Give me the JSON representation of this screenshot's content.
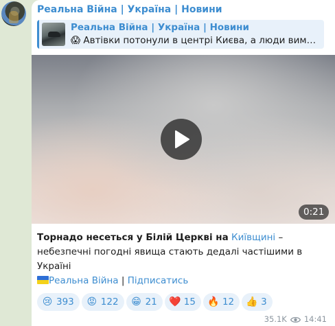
{
  "channel": {
    "name": "Реальна Війна | Україна | Новини"
  },
  "reply": {
    "name": "Реальна Війна | Україна | Новини",
    "emoji": "😱",
    "text": "Автівки потонули в центрі Києва, а люди вимушен…"
  },
  "video": {
    "duration": "0:21"
  },
  "caption": {
    "bold": "Торнадо несеться у Білій Церкві на",
    "link": "Київщині",
    "rest": "– небезпечні погодні явища стають дедалі частішими в Україні"
  },
  "links": {
    "channel": "Реальна Війна",
    "separator": "|",
    "subscribe": "Підписатись"
  },
  "reactions": [
    {
      "emoji": "😢",
      "count": "393"
    },
    {
      "emoji": "😡",
      "count": "122"
    },
    {
      "emoji": "😁",
      "count": "21"
    },
    {
      "emoji": "❤️",
      "count": "15"
    },
    {
      "emoji": "🔥",
      "count": "12"
    },
    {
      "emoji": "👍",
      "count": "3"
    }
  ],
  "meta": {
    "views": "35.1K",
    "time": "14:41"
  },
  "colors": {
    "accent": "#3d8dd0",
    "background": "#dfe8d5",
    "reaction_bg": "#e8f1fa"
  }
}
